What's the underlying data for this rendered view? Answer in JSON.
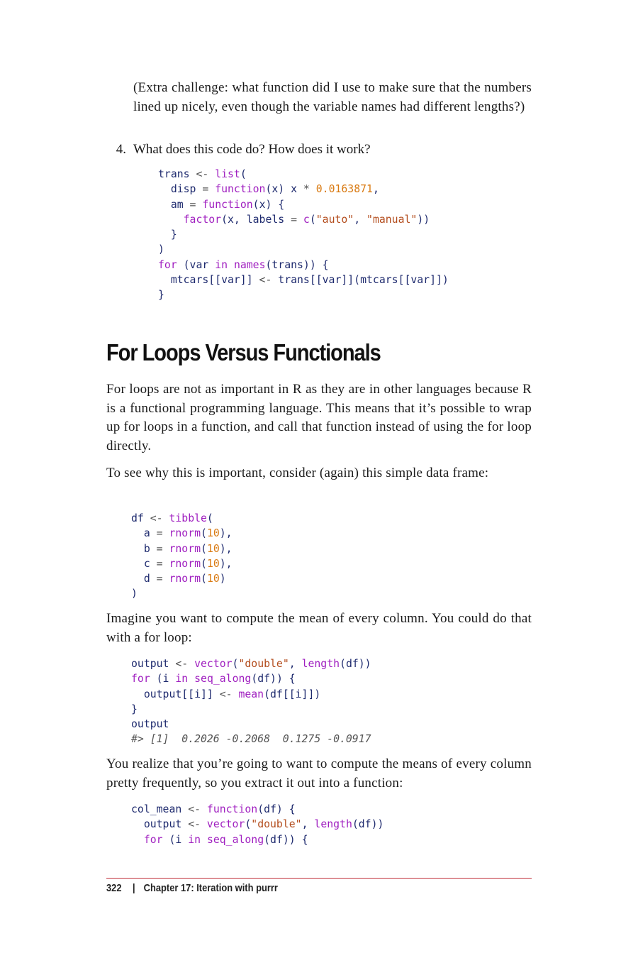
{
  "intro": {
    "challenge": "(Extra challenge: what function did I use to make sure that the numbers lined up nicely, even though the variable names had different lengths?)"
  },
  "item4": {
    "number": "4.",
    "text": "What does this code do? How does it work?"
  },
  "code_trans": [
    [
      [
        "var",
        "trans "
      ],
      [
        "op",
        "<- "
      ],
      [
        "fn",
        "list"
      ],
      [
        "var",
        "("
      ]
    ],
    [
      [
        "var",
        "  disp "
      ],
      [
        "op",
        "= "
      ],
      [
        "fn",
        "function"
      ],
      [
        "var",
        "(x) x "
      ],
      [
        "op",
        "* "
      ],
      [
        "num-lit",
        "0.0163871"
      ],
      [
        "var",
        ","
      ]
    ],
    [
      [
        "var",
        "  am "
      ],
      [
        "op",
        "= "
      ],
      [
        "fn",
        "function"
      ],
      [
        "var",
        "(x) {"
      ]
    ],
    [
      [
        "var",
        "    "
      ],
      [
        "fn",
        "factor"
      ],
      [
        "var",
        "(x, labels "
      ],
      [
        "op",
        "= "
      ],
      [
        "fn",
        "c"
      ],
      [
        "var",
        "("
      ],
      [
        "str",
        "\"auto\""
      ],
      [
        "var",
        ", "
      ],
      [
        "str",
        "\"manual\""
      ],
      [
        "var",
        "))"
      ]
    ],
    [
      [
        "var",
        "  }"
      ]
    ],
    [
      [
        "var",
        ")"
      ]
    ],
    [
      [
        "kw",
        "for"
      ],
      [
        "var",
        " (var "
      ],
      [
        "kw",
        "in"
      ],
      [
        "var",
        " "
      ],
      [
        "fn",
        "names"
      ],
      [
        "var",
        "(trans)) {"
      ]
    ],
    [
      [
        "var",
        "  mtcars[[var]] "
      ],
      [
        "op",
        "<- "
      ],
      [
        "var",
        "trans[[var]](mtcars[[var]])"
      ]
    ],
    [
      [
        "var",
        "}"
      ]
    ]
  ],
  "section": {
    "title": "For Loops Versus Functionals"
  },
  "paragraphs": {
    "p1": "For loops are not as important in R as they are in other languages because R is a functional programming language. This means that it’s possible to wrap up for loops in a function, and call that function instead of using the for loop directly.",
    "p2": "To see why this is important, consider (again) this simple data frame:",
    "p3": "Imagine you want to compute the mean of every column. You could do that with a for loop:",
    "p4": "You realize that you’re going to want to compute the means of every column pretty frequently, so you extract it out into a function:"
  },
  "code_df": [
    [
      [
        "var",
        "df "
      ],
      [
        "op",
        "<- "
      ],
      [
        "fn",
        "tibble"
      ],
      [
        "var",
        "("
      ]
    ],
    [
      [
        "var",
        "  a "
      ],
      [
        "op",
        "= "
      ],
      [
        "fn",
        "rnorm"
      ],
      [
        "var",
        "("
      ],
      [
        "num-lit",
        "10"
      ],
      [
        "var",
        "),"
      ]
    ],
    [
      [
        "var",
        "  b "
      ],
      [
        "op",
        "= "
      ],
      [
        "fn",
        "rnorm"
      ],
      [
        "var",
        "("
      ],
      [
        "num-lit",
        "10"
      ],
      [
        "var",
        "),"
      ]
    ],
    [
      [
        "var",
        "  c "
      ],
      [
        "op",
        "= "
      ],
      [
        "fn",
        "rnorm"
      ],
      [
        "var",
        "("
      ],
      [
        "num-lit",
        "10"
      ],
      [
        "var",
        "),"
      ]
    ],
    [
      [
        "var",
        "  d "
      ],
      [
        "op",
        "= "
      ],
      [
        "fn",
        "rnorm"
      ],
      [
        "var",
        "("
      ],
      [
        "num-lit",
        "10"
      ],
      [
        "var",
        ")"
      ]
    ],
    [
      [
        "var",
        ")"
      ]
    ]
  ],
  "code_loop": [
    [
      [
        "var",
        "output "
      ],
      [
        "op",
        "<- "
      ],
      [
        "fn",
        "vector"
      ],
      [
        "var",
        "("
      ],
      [
        "str",
        "\"double\""
      ],
      [
        "var",
        ", "
      ],
      [
        "fn",
        "length"
      ],
      [
        "var",
        "(df))"
      ]
    ],
    [
      [
        "kw",
        "for"
      ],
      [
        "var",
        " (i "
      ],
      [
        "kw",
        "in"
      ],
      [
        "var",
        " "
      ],
      [
        "fn",
        "seq_along"
      ],
      [
        "var",
        "(df)) {"
      ]
    ],
    [
      [
        "var",
        "  output[[i]] "
      ],
      [
        "op",
        "<- "
      ],
      [
        "fn",
        "mean"
      ],
      [
        "var",
        "(df[[i]])"
      ]
    ],
    [
      [
        "var",
        "}"
      ]
    ],
    [
      [
        "var",
        "output"
      ]
    ],
    [
      [
        "cmt",
        "#> [1]  0.2026 -0.2068  0.1275 -0.0917"
      ]
    ]
  ],
  "code_colmean": [
    [
      [
        "var",
        "col_mean "
      ],
      [
        "op",
        "<- "
      ],
      [
        "fn",
        "function"
      ],
      [
        "var",
        "(df) {"
      ]
    ],
    [
      [
        "var",
        "  output "
      ],
      [
        "op",
        "<- "
      ],
      [
        "fn",
        "vector"
      ],
      [
        "var",
        "("
      ],
      [
        "str",
        "\"double\""
      ],
      [
        "var",
        ", "
      ],
      [
        "fn",
        "length"
      ],
      [
        "var",
        "(df))"
      ]
    ],
    [
      [
        "var",
        "  "
      ],
      [
        "kw",
        "for"
      ],
      [
        "var",
        " (i "
      ],
      [
        "kw",
        "in"
      ],
      [
        "var",
        " "
      ],
      [
        "fn",
        "seq_along"
      ],
      [
        "var",
        "(df)) {"
      ]
    ]
  ],
  "footer": {
    "page_number": "322",
    "separator": "|",
    "chapter": "Chapter 17: Iteration with purrr"
  },
  "colors": {
    "keyword": "#a020c0",
    "string": "#b34c1c",
    "number": "#d97a12",
    "identifier": "#1e2a6e",
    "rule": "#c0303a"
  }
}
